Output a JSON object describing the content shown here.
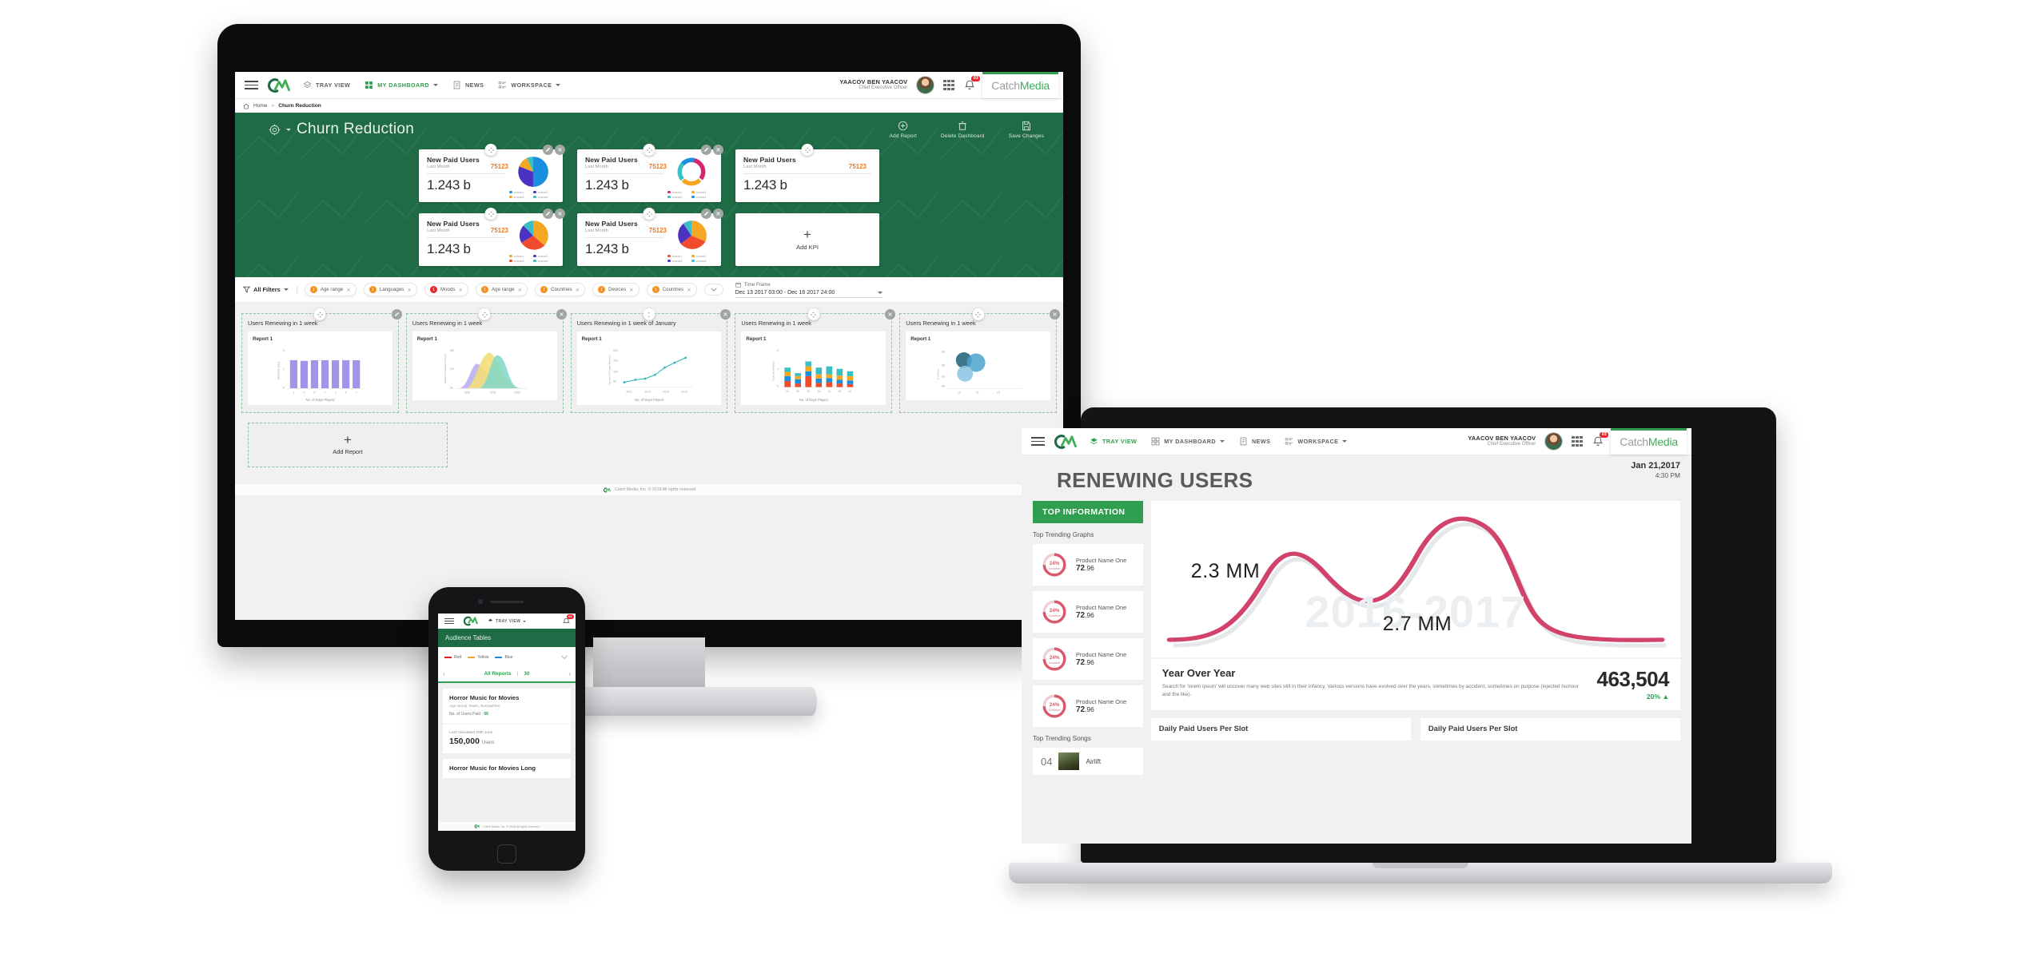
{
  "app": {
    "brand": {
      "prefix": "Catch",
      "suffix": "Media"
    },
    "nav": {
      "tray_view": "TRAY VIEW",
      "my_dashboard": "MY DASHBOARD",
      "news": "NEWS",
      "workspace": "WORKSPACE"
    },
    "user": {
      "name": "YAACOV BEN YAACOV",
      "role": "Chief Executive Officer"
    },
    "notifications_badge": "03",
    "footer": "Catch Media, Inc. © 2018 All rights reserved"
  },
  "desktop": {
    "breadcrumb": {
      "home": "Home",
      "separator": "»",
      "current": "Churn Reduction"
    },
    "page_title": "Churn Reduction",
    "actions": [
      {
        "label": "Add Report",
        "icon": "add-circle-icon"
      },
      {
        "label": "Delete Dashboard",
        "icon": "trash-icon"
      },
      {
        "label": "Save Changes",
        "icon": "save-icon"
      }
    ],
    "kpis": [
      {
        "title": "New Paid Users",
        "subtitle": "Last Month",
        "number": "75123",
        "value": "1.243 b",
        "chart": "pie",
        "legend": [
          "colour1",
          "colour2",
          "colour3",
          "colour4"
        ],
        "colors": [
          "#1a8fe0",
          "#4b32c3",
          "#f5a623",
          "#3bbfc4"
        ]
      },
      {
        "title": "New Paid Users",
        "subtitle": "Last Month",
        "number": "75123",
        "value": "1.243 b",
        "chart": "donut",
        "legend": [
          "colour1",
          "colour2",
          "colour3",
          "colour4"
        ],
        "colors": [
          "#d6246e",
          "#3bbfc4",
          "#f5a623",
          "#1a8fe0"
        ]
      },
      {
        "title": "New Paid Users",
        "subtitle": "Last Month",
        "number": "75123",
        "value": "1.243 b",
        "chart": "none",
        "legend": [],
        "colors": []
      },
      {
        "title": "New Paid Users",
        "subtitle": "Last Month",
        "number": "75123",
        "value": "1.243 b",
        "chart": "pie",
        "legend": [
          "colour1",
          "colour2",
          "colour3",
          "colour4"
        ],
        "colors": [
          "#f5a623",
          "#4b32c3",
          "#ef4b2c",
          "#3bbfc4"
        ]
      },
      {
        "title": "New Paid Users",
        "subtitle": "Last Month",
        "number": "75123",
        "value": "1.243 b",
        "chart": "pie",
        "legend": [
          "colour1",
          "colour2",
          "colour3",
          "colour4"
        ],
        "colors": [
          "#ef4b2c",
          "#f5a623",
          "#4b32c3",
          "#3bbfc4"
        ]
      }
    ],
    "add_kpi": {
      "label": "Add KPI",
      "plus": "+"
    },
    "filters": {
      "all_filters": "All Filters",
      "chips": [
        {
          "label": "Age range",
          "count": "1",
          "alert": false
        },
        {
          "label": "Languages",
          "count": "1",
          "alert": false
        },
        {
          "label": "Moods",
          "count": "1",
          "alert": true
        },
        {
          "label": "Age range",
          "count": "1",
          "alert": false
        },
        {
          "label": "Countries",
          "count": "1",
          "alert": false
        },
        {
          "label": "Devices",
          "count": "1",
          "alert": false
        },
        {
          "label": "Countries",
          "count": "1",
          "alert": false
        }
      ],
      "timeframe_label": "Time Frame",
      "timeframe_value": "Dec 13 2017 03:00 - Dec 16 2017 24:00"
    },
    "reports": [
      {
        "title": "Users Renewing in 1 week",
        "sub": "Report 1",
        "chart": "bar",
        "ylabel": "Sessions (per)",
        "xlabel": "No. of Days Played"
      },
      {
        "title": "Users Renewing in 1 week",
        "sub": "Report 1",
        "chart": "area",
        "ylabel": "Number of People Involved",
        "xlabel": ""
      },
      {
        "title": "Users Renewing in 1 week of January",
        "sub": "Report 1",
        "chart": "line",
        "ylabel": "Number of People Opened",
        "xlabel": "No. of Days Played"
      },
      {
        "title": "Users Renewing in 1 week",
        "sub": "Report 1",
        "chart": "stacked",
        "ylabel": "Count (in Millions)",
        "xlabel": "No. of Days Played"
      },
      {
        "title": "Users Renewing in 1 week",
        "sub": "Report 1",
        "chart": "bubble",
        "ylabel": "% of Paid",
        "xlabel": ""
      }
    ],
    "add_report": {
      "label": "Add Report",
      "plus": "+"
    }
  },
  "laptop": {
    "date": "Jan 21,2017",
    "time": "4:30 PM",
    "headline": "RENEWING USERS",
    "sidebar": {
      "top_information": "TOP INFORMATION",
      "trending_graphs_label": "Top Trending Graphs",
      "graphs": [
        {
          "name": "Product Name One",
          "value_int": "72",
          "value_dec": ".96",
          "pct": "24%",
          "pct_sub": "Available"
        },
        {
          "name": "Product Name One",
          "value_int": "72",
          "value_dec": ".96",
          "pct": "24%",
          "pct_sub": "Available"
        },
        {
          "name": "Product Name One",
          "value_int": "72",
          "value_dec": ".96",
          "pct": "24%",
          "pct_sub": "Available"
        },
        {
          "name": "Product Name One",
          "value_int": "72",
          "value_dec": ".96",
          "pct": "24%",
          "pct_sub": "Available"
        }
      ],
      "trending_songs_label": "Top Trending Songs",
      "songs": [
        {
          "rank": "04",
          "title": "Airlift"
        }
      ]
    },
    "curve": {
      "watermark": "2016-2017",
      "peak_left": "2.3 MM",
      "peak_right": "2.7 MM"
    },
    "yoy": {
      "title": "Year Over Year",
      "text": "Search for 'lorem ipsum' will uncover many web sites still in their infancy. Various versions have evolved over the years, sometimes by accident, sometimes on purpose (injected humour and the like).",
      "number": "463,504",
      "delta": "20% ▲"
    },
    "bottom_panels": [
      "Daily Paid Users Per Slot",
      "Daily Paid Users Per Slot"
    ]
  },
  "phone": {
    "nav_item": "TRAY VIEW",
    "badge": "03",
    "section_title": "Audience Tables",
    "legend": [
      {
        "label": "Red",
        "color": "#e02020"
      },
      {
        "label": "Yellow",
        "color": "#f5a623"
      },
      {
        "label": "Blue",
        "color": "#1a8fe0"
      }
    ],
    "reports_label": "All Reports",
    "reports_count": "30",
    "cards": [
      {
        "title": "Horror Music for Movies",
        "meta": "Age Group: Music, Everywhere",
        "row_label": "No. of Users Paid :",
        "row_value": "06"
      },
      {
        "small": "Last calculated 20th June",
        "big": "150,000",
        "big_unit": "Users"
      },
      {
        "title": "Horror Music for Movies Long"
      }
    ],
    "footer": "Catch Media, Inc. © 2018 All rights reserved"
  },
  "colors": {
    "brand_green": "#2f9e4f",
    "dark_green": "#1f6b45",
    "orange": "#ef7622",
    "alert_red": "#e8262d",
    "pink_curve": "#d1436b"
  }
}
